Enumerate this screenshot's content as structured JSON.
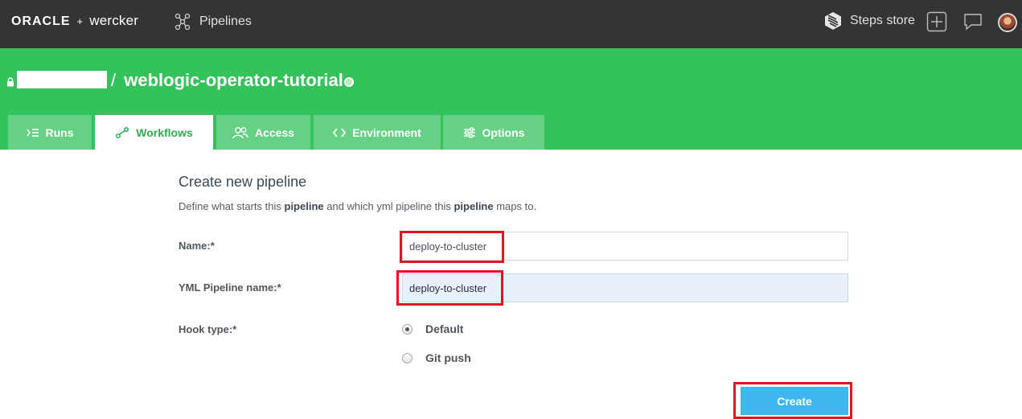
{
  "topbar": {
    "brand_oracle": "ORACLE",
    "brand_plus": "+",
    "brand_wercker": "wercker",
    "pipelines_label": "Pipelines",
    "steps_store_label": "Steps store"
  },
  "project": {
    "owner_redacted": "",
    "separator": "/",
    "name": "weblogic-operator-tutorial"
  },
  "tabs": [
    {
      "label": "Runs",
      "icon": "runs-icon",
      "active": false
    },
    {
      "label": "Workflows",
      "icon": "workflows-icon",
      "active": true
    },
    {
      "label": "Access",
      "icon": "access-icon",
      "active": false
    },
    {
      "label": "Environment",
      "icon": "code-icon",
      "active": false
    },
    {
      "label": "Options",
      "icon": "options-icon",
      "active": false
    }
  ],
  "form": {
    "title": "Create new pipeline",
    "desc_part1": "Define what starts this ",
    "desc_bold1": "pipeline",
    "desc_part2": " and which yml pipeline this ",
    "desc_bold2": "pipeline",
    "desc_part3": " maps to.",
    "name_label": "Name:*",
    "name_value": "deploy-to-cluster",
    "yml_label": "YML Pipeline name:*",
    "yml_value": "deploy-to-cluster",
    "hook_label": "Hook type:*",
    "hook_options": [
      {
        "label": "Default",
        "checked": true
      },
      {
        "label": "Git push",
        "checked": false
      }
    ],
    "create_label": "Create"
  },
  "colors": {
    "topbar": "#343434",
    "brand_green": "#34c35a",
    "tab_inactive": "#66d184",
    "create_button": "#3fb6ee",
    "highlight": "#e3141f"
  }
}
